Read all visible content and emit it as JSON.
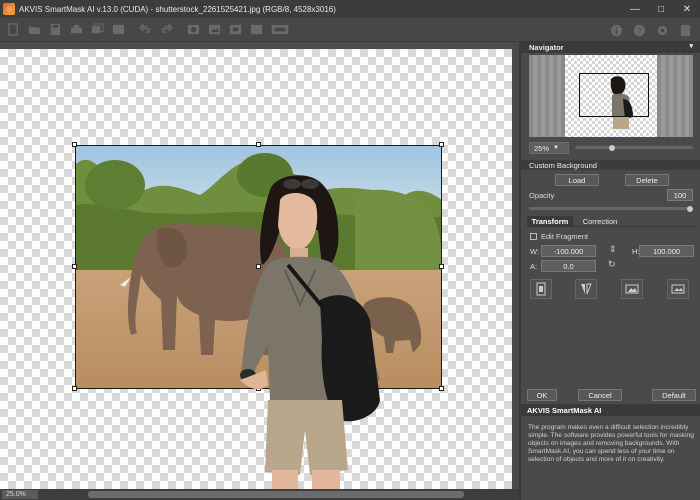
{
  "window": {
    "title": "AKVIS SmartMask AI v.13.0 (CUDA) - shutterstock_2261525421.jpg (RGB/8, 4528x3016)",
    "minimize": "—",
    "maximize": "□",
    "close": "✕"
  },
  "toolbar": {
    "icons": [
      "new-icon",
      "open-icon",
      "save-icon",
      "print-icon",
      "batch-icon",
      "share-icon",
      "undo-icon",
      "redo-icon",
      "mask-icon",
      "cutout-icon",
      "transform-icon",
      "background-icon",
      "gpu-icon"
    ],
    "right_icons": [
      "info-icon",
      "help-icon",
      "settings-icon",
      "feed-icon"
    ]
  },
  "status": {
    "zoom": "25.0%"
  },
  "navigator": {
    "title": "Navigator",
    "zoom": "25%"
  },
  "custom_background": {
    "title": "Custom Background",
    "load": "Load",
    "delete": "Delete",
    "opacity_label": "Opacity",
    "opacity_value": "100"
  },
  "tabs": {
    "transform": "Transform",
    "correction": "Correction"
  },
  "transform": {
    "edit_fragment": "Edit Fragment",
    "w_label": "W:",
    "w_value": "-100.000",
    "h_label": "H:",
    "h_value": "100.000",
    "a_label": "A:",
    "a_value": "0.0"
  },
  "dialog_buttons": {
    "ok": "OK",
    "cancel": "Cancel",
    "default": "Default"
  },
  "help": {
    "title": "AKVIS SmartMask AI",
    "text": "The program makes even a difficult selection incredibly simple. The software provides powerful tools for masking objects on images and removing backgrounds. With SmartMask AI, you can spend less of your time on selection of objects and more of it on creativity."
  },
  "colors": {
    "panel_bg": "#4a4a4a",
    "header_bg": "#3a3a3a",
    "sky": "#a9c8e0",
    "ground": "#c79a70"
  }
}
